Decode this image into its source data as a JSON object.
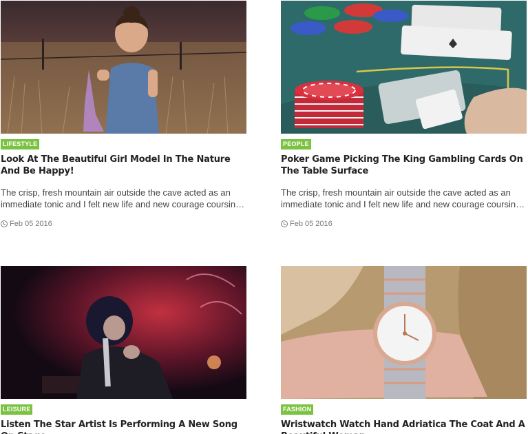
{
  "posts": [
    {
      "category": "LIFESTYLE",
      "title": "Look At The Beautiful Girl Model In The Nature And Be Happy!",
      "excerpt": "The crisp, fresh mountain air outside the cave acted as an immediate tonic and I felt new life and new courage coursing through me.",
      "date": "Feb 05 2016",
      "image_icon": "girl-in-field-photo"
    },
    {
      "category": "PEOPLE",
      "title": "Poker Game Picking The King Gambling Cards On The Table Surface",
      "excerpt": "The crisp, fresh mountain air outside the cave acted as an immediate tonic and I felt new life and new courage coursing through me.",
      "date": "Feb 05 2016",
      "image_icon": "poker-chips-cards-photo"
    },
    {
      "category": "LEISURE",
      "title": "Listen The Star Artist Is Performing A New Song On Stage",
      "excerpt": "",
      "date": "",
      "image_icon": "singer-on-stage-photo"
    },
    {
      "category": "FASHION",
      "title": "Wristwatch Watch Hand Adriatica The Coat And A Beautiful Woman",
      "excerpt": "",
      "date": "",
      "image_icon": "wristwatch-photo"
    }
  ],
  "colors": {
    "category_bg": "#7cc242"
  }
}
